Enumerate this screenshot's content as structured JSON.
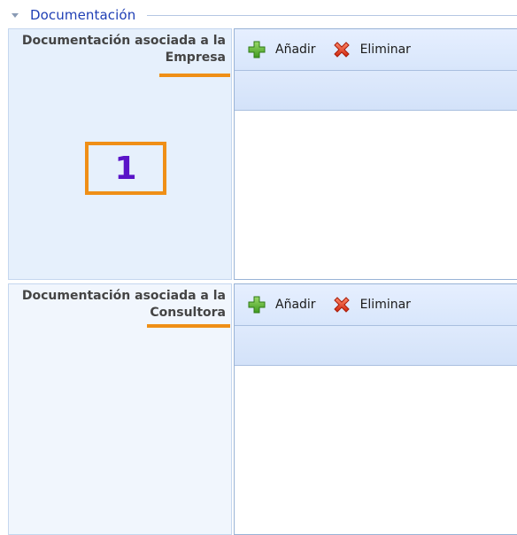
{
  "section": {
    "title": "Documentación"
  },
  "rows": [
    {
      "label_line1": "Documentación asociada a la",
      "label_line2": "Empresa",
      "toolbar": {
        "add_label": "Añadir",
        "delete_label": "Eliminar"
      }
    },
    {
      "label_line1": "Documentación asociada a la",
      "label_line2": "Consultora",
      "toolbar": {
        "add_label": "Añadir",
        "delete_label": "Eliminar"
      }
    }
  ],
  "callout": {
    "number": "1"
  },
  "icons": {
    "collapse": "triangle-down-icon",
    "add": "green-plus-icon",
    "delete": "red-x-icon"
  },
  "colors": {
    "accent": "#ef8f16",
    "title": "#1f3fb5",
    "callout_text": "#5a14c8",
    "highlight_bg": "#e6f0fc",
    "normal_bg": "#f1f6fd"
  }
}
